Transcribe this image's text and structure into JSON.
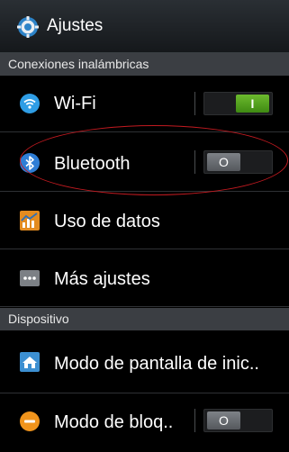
{
  "header": {
    "title": "Ajustes",
    "icon": "gear-icon"
  },
  "sections": {
    "wireless": "Conexiones inalámbricas",
    "device": "Dispositivo"
  },
  "items": {
    "wifi": {
      "label": "Wi-Fi",
      "icon": "wifi-icon",
      "toggle_on": true,
      "toggle_text": "I",
      "color": "#2f9de5"
    },
    "bluetooth": {
      "label": "Bluetooth",
      "icon": "bluetooth-icon",
      "toggle_on": false,
      "toggle_text": "O",
      "color": "#2f7ed6"
    },
    "data_usage": {
      "label": "Uso de datos",
      "icon": "data-usage-icon",
      "color": "#e38b1f"
    },
    "more_settings": {
      "label": "Más ajustes",
      "icon": "more-icon"
    },
    "home_screen": {
      "label": "Modo de pantalla de inic..",
      "icon": "home-icon"
    },
    "lock_mode": {
      "label": "Modo de bloq..",
      "icon": "lock-mode-icon",
      "toggle_on": false,
      "toggle_text": "O",
      "color": "#f0941c"
    }
  },
  "colors": {
    "toggle_on": "#5aa823",
    "section_bg": "#3b3e43",
    "annotation": "#c21a20"
  }
}
